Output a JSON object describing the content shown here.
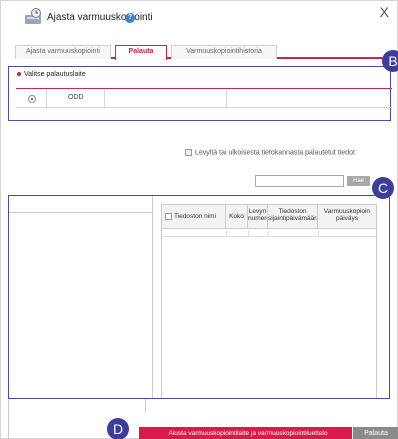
{
  "window": {
    "title": "Ajasta varmuuskopiointi",
    "close_label": "X",
    "help_label": "?"
  },
  "tabs": [
    {
      "label": "Ajasta varmuuskopiointi",
      "active": false
    },
    {
      "label": "Palauta",
      "active": true
    },
    {
      "label": "Varmuuskopiointihistoria",
      "active": false
    }
  ],
  "restore_device": {
    "heading": "Valitse palautuslaite",
    "selected_device": "ODD"
  },
  "external_db_checkbox": {
    "label": "Levyltä tai ulkoisesta tietokannasta palautetut tiedot",
    "checked": false
  },
  "search": {
    "value": "",
    "button_label": "Hae"
  },
  "file_table": {
    "columns": [
      "Tiedoston nimi",
      "Koko",
      "Levyn numero",
      "Tiedoston sijaintipäivämäärä",
      "Varmuuskopioin päiväys"
    ]
  },
  "buttons": {
    "reset": "Alusta varmuuskopiointilaite ja varmuuskopiointiluettelo",
    "restore": "Palauta"
  },
  "callouts": [
    "B",
    "C",
    "D"
  ],
  "colors": {
    "accent": "#c6264f",
    "callout": "#3d3d9e",
    "reset_button": "#d81b4a",
    "restore_button": "#8a8a8a"
  },
  "icons": {
    "app": "backup-schedule-icon",
    "help": "help-icon"
  }
}
